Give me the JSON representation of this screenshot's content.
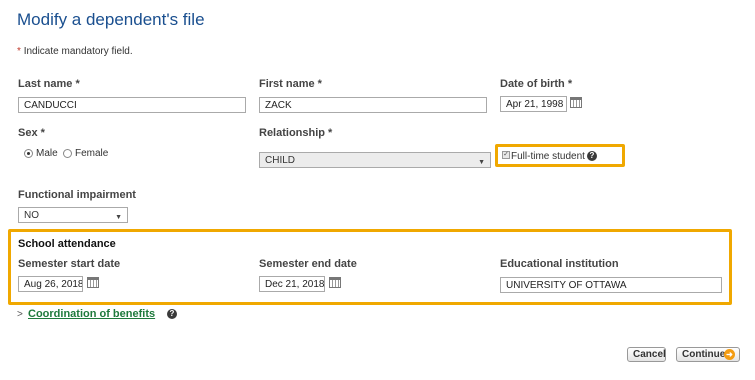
{
  "page": {
    "title": "Modify a dependent's file",
    "mandatory_note_star": "*",
    "mandatory_note": "Indicate mandatory field."
  },
  "fields": {
    "last_name": {
      "label": "Last name *",
      "value": "CANDUCCI"
    },
    "first_name": {
      "label": "First name *",
      "value": "ZACK"
    },
    "dob": {
      "label": "Date of birth *",
      "value": "Apr 21, 1998"
    },
    "sex": {
      "label": "Sex *",
      "options": [
        "Male",
        "Female"
      ],
      "selected": "Male"
    },
    "relationship": {
      "label": "Relationship *",
      "value": "CHILD"
    },
    "full_time": {
      "label": "Full-time student",
      "checked": true
    },
    "impairment": {
      "label": "Functional impairment",
      "value": "NO"
    }
  },
  "school": {
    "heading": "School attendance",
    "start": {
      "label": "Semester start date",
      "value": "Aug 26, 2018"
    },
    "end": {
      "label": "Semester end date",
      "value": "Dec 21, 2018"
    },
    "institution": {
      "label": "Educational institution",
      "value": "UNIVERSITY OF OTTAWA"
    }
  },
  "coordination": {
    "label": "Coordination of benefits",
    "chevron": ">"
  },
  "buttons": {
    "cancel": "Cancel",
    "continue": "Continue"
  },
  "colors": {
    "highlight": "#f0a800",
    "title": "#1a4f8f",
    "link": "#1e7a3c"
  }
}
